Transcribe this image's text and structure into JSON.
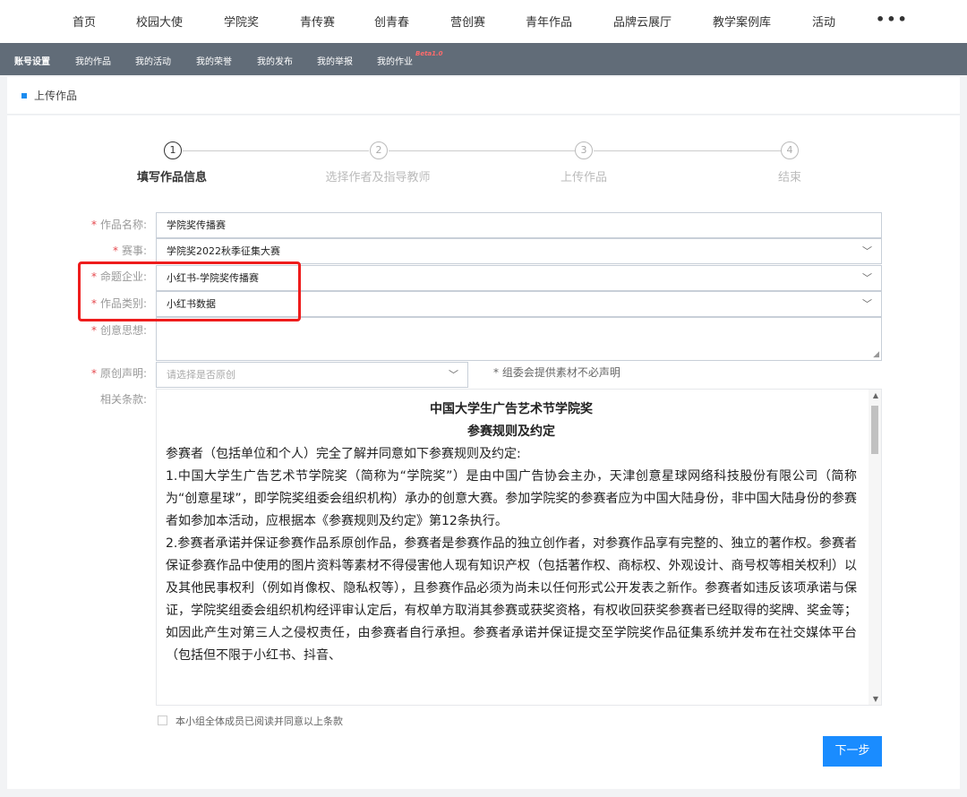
{
  "top_nav": {
    "items": [
      "首页",
      "校园大使",
      "学院奖",
      "青传赛",
      "创青春",
      "营创赛",
      "青年作品",
      "品牌云展厅",
      "教学案例库",
      "活动"
    ],
    "more": "•••"
  },
  "sub_nav": {
    "items": [
      "账号设置",
      "我的作品",
      "我的活动",
      "我的荣誉",
      "我的发布",
      "我的举报",
      "我的作业"
    ],
    "beta_badge": "Beta1.0"
  },
  "section": {
    "title": "上传作品"
  },
  "steps": [
    {
      "number": "1",
      "label": "填写作品信息"
    },
    {
      "number": "2",
      "label": "选择作者及指导教师"
    },
    {
      "number": "3",
      "label": "上传作品"
    },
    {
      "number": "4",
      "label": "结束"
    }
  ],
  "form": {
    "required_mark": "*",
    "work_name": {
      "label": "作品名称:",
      "value": "学院奖传播赛"
    },
    "competition": {
      "label": "赛事:",
      "value": "学院奖2022秋季征集大赛"
    },
    "company": {
      "label": "命题企业:",
      "value": "小红书-学院奖传播赛"
    },
    "category": {
      "label": "作品类别:",
      "value": "小红书数据"
    },
    "idea": {
      "label": "创意思想:",
      "value": ""
    },
    "originality": {
      "label": "原创声明:",
      "placeholder": "请选择是否原创",
      "note": "* 组委会提供素材不必声明"
    },
    "terms_label": "相关条款:"
  },
  "terms": {
    "title1": "中国大学生广告艺术节学院奖",
    "title2": "参赛规则及约定",
    "intro": "参赛者（包括单位和个人）完全了解并同意如下参赛规则及约定:",
    "p1": "1.中国大学生广告艺术节学院奖（简称为“学院奖”）是由中国广告协会主办，天津创意星球网络科技股份有限公司（简称为“创意星球”，即学院奖组委会组织机构）承办的创意大赛。参加学院奖的参赛者应为中国大陆身份，非中国大陆身份的参赛者如参加本活动，应根据本《参赛规则及约定》第12条执行。",
    "p2": "2.参赛者承诺并保证参赛作品系原创作品，参赛者是参赛作品的独立创作者，对参赛作品享有完整的、独立的著作权。参赛者保证参赛作品中使用的图片资料等素材不得侵害他人现有知识产权（包括著作权、商标权、外观设计、商号权等相关权利）以及其他民事权利（例如肖像权、隐私权等），且参赛作品必须为尚未以任何形式公开发表之新作。参赛者如违反该项承诺与保证，学院奖组委会组织机构经评审认定后，有权单方取消其参赛或获奖资格，有权收回获奖参赛者已经取得的奖牌、奖金等；如因此产生对第三人之侵权责任，由参赛者自行承担。参赛者承诺并保证提交至学院奖作品征集系统并发布在社交媒体平台（包括但不限于小红书、抖音、"
  },
  "agreement": {
    "label": "本小组全体成员已阅读并同意以上条款"
  },
  "buttons": {
    "next": "下一步"
  },
  "colors": {
    "primary": "#1a8cff",
    "subnav_bg": "#616c78",
    "highlight": "#ee1c1c",
    "required": "#e5484d"
  },
  "icons": {
    "dropdown": "chevron-down-icon",
    "step_marker": "square-marker-icon"
  }
}
